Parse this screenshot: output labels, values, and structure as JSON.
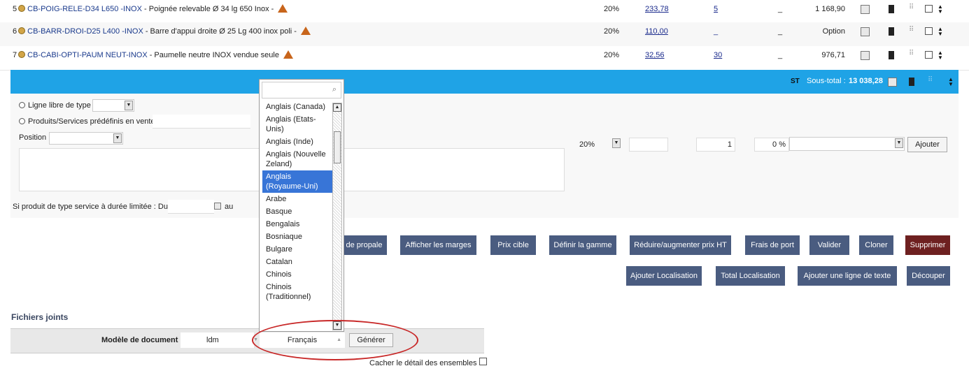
{
  "lines": [
    {
      "num": "5",
      "ref": "CB-POIG-RELE-D34 L650 -INOX",
      "desc": " - Poignée relevable Ø 34 lg 650 Inox - ",
      "tva": "20%",
      "pu": "233,78",
      "qty": "5",
      "disc": "_",
      "total": "1 168,90"
    },
    {
      "num": "6",
      "ref": "CB-BARR-DROI-D25 L400 -INOX",
      "desc": " - Barre d'appui droite Ø 25 Lg 400 inox poli - ",
      "tva": "20%",
      "pu": "110,00",
      "qty": "_",
      "disc": "_",
      "total": "Option"
    },
    {
      "num": "7",
      "ref": "CB-CABI-OPTI-PAUM NEUT-INOX",
      "desc": " - Paumelle neutre INOX vendue seule ",
      "tva": "20%",
      "pu": "32,56",
      "qty": "30",
      "disc": "_",
      "total": "976,71"
    }
  ],
  "subtotal": {
    "badge": "ST",
    "label": "Sous-total : ",
    "value": "13 038,28"
  },
  "form": {
    "radio_free_line": "Ligne libre de type",
    "radio_predefined": "Produits/Services prédéfinis en vente",
    "position_label": "Position",
    "tva_value": "20%",
    "qty_value": "1",
    "discount_value": "0 %",
    "add_button": "Ajouter",
    "service_label": "Si produit de type service à durée limitée : Du",
    "service_to": "au"
  },
  "buttons_row1": [
    "de propale",
    "Afficher les marges",
    "Prix cible",
    "Définir la gamme",
    "Réduire/augmenter prix HT",
    "Frais de port",
    "Valider",
    "Cloner",
    "Supprimer"
  ],
  "buttons_row2": [
    "Ajouter Localisation",
    "Total Localisation",
    "Ajouter une ligne de texte",
    "Découper"
  ],
  "files": {
    "title": "Fichiers joints",
    "model_label": "Modèle de document",
    "model_value": "ldm",
    "lang_value": "Français",
    "generate": "Générer",
    "hide_detail": "Cacher le détail des ensembles"
  },
  "language_dropdown": {
    "options": [
      "Anglais (Canada)",
      "Anglais (Etats-Unis)",
      "Anglais (Inde)",
      "Anglais (Nouvelle Zeland)",
      "Anglais (Royaume-Uni)",
      "Arabe",
      "Basque",
      "Bengalais",
      "Bosniaque",
      "Bulgare",
      "Catalan",
      "Chinois",
      "Chinois (Traditionnel)"
    ],
    "selected": "Anglais (Royaume-Uni)"
  },
  "colors": {
    "accent": "#1fa3e6",
    "button": "#4a5c80",
    "danger": "#6e2020",
    "highlight": "#c82828"
  }
}
